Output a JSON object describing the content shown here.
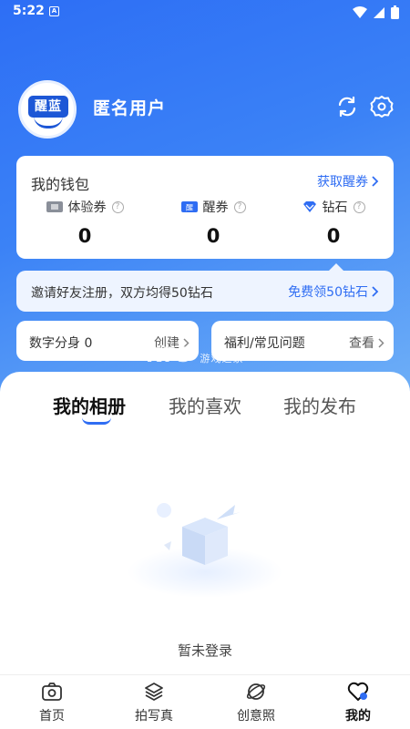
{
  "status_bar": {
    "time": "5:22",
    "sim_label": "A"
  },
  "profile": {
    "avatar_text": "醒蓝",
    "username": "匿名用户"
  },
  "wallet": {
    "title": "我的钱包",
    "get_link": "获取醒券",
    "items": [
      {
        "label": "体验券",
        "value": "0",
        "help": "?"
      },
      {
        "label": "醒券",
        "value": "0",
        "help": "?"
      },
      {
        "label": "钻石",
        "value": "0",
        "help": "?"
      }
    ]
  },
  "invite": {
    "text": "邀请好友注册，双方均得50钻石",
    "action": "免费领50钻石"
  },
  "cards": {
    "digital": {
      "label": "数字分身 0",
      "action": "创建"
    },
    "faq": {
      "label": "福利/常见问题",
      "action": "查看"
    }
  },
  "tabs": [
    "我的相册",
    "我的喜欢",
    "我的发布"
  ],
  "empty_text": "暂未登录",
  "nav": [
    "首页",
    "拍写真",
    "创意照",
    "我的"
  ],
  "watermark": {
    "main": "K73",
    "sub": "游戏之家"
  },
  "colors": {
    "accent": "#2f6df3",
    "hero_start": "#2d6ef5",
    "hero_end": "#6fb0f7"
  },
  "icons": [
    "camera-icon",
    "layers-icon",
    "planet-icon",
    "heart-icon",
    "refresh-icon",
    "gear-icon"
  ]
}
